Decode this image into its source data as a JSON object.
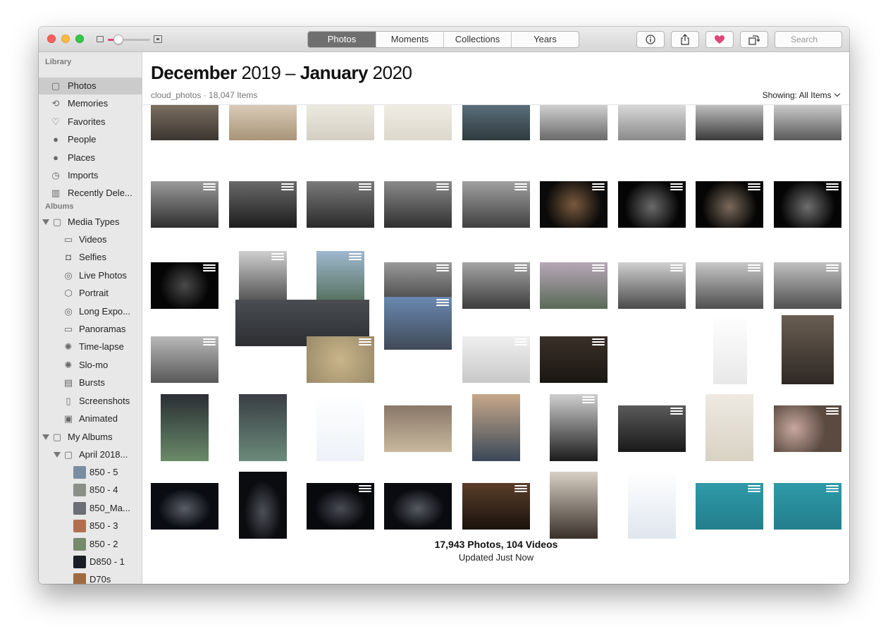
{
  "toolbar": {
    "tabs": [
      {
        "label": "Photos",
        "active": true
      },
      {
        "label": "Moments",
        "active": false
      },
      {
        "label": "Collections",
        "active": false
      },
      {
        "label": "Years",
        "active": false
      }
    ],
    "zoom_level": 0.25,
    "info_icon": "info-icon",
    "share_icon": "share-icon",
    "favorite_icon": "heart-icon",
    "rotate_icon": "rotate-icon",
    "search_placeholder": "Search"
  },
  "sidebar": {
    "library_header": "Library",
    "library_items": [
      {
        "label": "Photos",
        "icon": "photos-icon",
        "selected": true
      },
      {
        "label": "Memories",
        "icon": "memories-icon"
      },
      {
        "label": "Favorites",
        "icon": "heart-icon"
      },
      {
        "label": "People",
        "icon": "person-icon"
      },
      {
        "label": "Places",
        "icon": "pin-icon"
      },
      {
        "label": "Imports",
        "icon": "clock-icon"
      },
      {
        "label": "Recently Dele...",
        "icon": "trash-icon"
      }
    ],
    "albums_header": "Albums",
    "media_types_label": "Media Types",
    "media_types": [
      {
        "label": "Videos",
        "icon": "video-icon"
      },
      {
        "label": "Selfies",
        "icon": "camera-icon"
      },
      {
        "label": "Live Photos",
        "icon": "live-photo-icon"
      },
      {
        "label": "Portrait",
        "icon": "cube-icon"
      },
      {
        "label": "Long Expo...",
        "icon": "long-exposure-icon"
      },
      {
        "label": "Panoramas",
        "icon": "panorama-icon"
      },
      {
        "label": "Time-lapse",
        "icon": "timelapse-icon"
      },
      {
        "label": "Slo-mo",
        "icon": "slomo-icon"
      },
      {
        "label": "Bursts",
        "icon": "bursts-icon"
      },
      {
        "label": "Screenshots",
        "icon": "phone-icon"
      },
      {
        "label": "Animated",
        "icon": "animated-icon"
      }
    ],
    "my_albums_label": "My Albums",
    "folder_label": "April 2018...",
    "albums": [
      {
        "label": "850 - 5",
        "color": "#7a8ea0"
      },
      {
        "label": "850 - 4",
        "color": "#8b8f88"
      },
      {
        "label": "850_Ma...",
        "color": "#6b6e73"
      },
      {
        "label": "850 - 3",
        "color": "#b07050"
      },
      {
        "label": "850 - 2",
        "color": "#768a6c"
      },
      {
        "label": "D850 - 1",
        "color": "#1a1d24"
      },
      {
        "label": "D70s",
        "color": "#a06a40"
      }
    ]
  },
  "main": {
    "title_month_1": "December",
    "title_year_1": " 2019 – ",
    "title_month_2": "January",
    "title_year_2": " 2020",
    "subtitle": "cloud_photos · 18,047 Items",
    "showing_label": "Showing:",
    "showing_value": "All Items",
    "footer_count": "17,943 Photos, 104 Videos",
    "footer_updated": "Updated Just Now"
  },
  "photos": [
    {
      "row": 0,
      "col": 0,
      "bg": "linear-gradient(#7b6e60,#3c3530)",
      "kind": "photo"
    },
    {
      "row": 0,
      "col": 1,
      "bg": "linear-gradient(#d9cbb8,#a89478)",
      "kind": "photo"
    },
    {
      "row": 0,
      "col": 2,
      "bg": "linear-gradient(#ece9e0,#d4cfc2)",
      "kind": "photo"
    },
    {
      "row": 0,
      "col": 3,
      "bg": "linear-gradient(#efece4,#dcd8cc)",
      "kind": "photo"
    },
    {
      "row": 0,
      "col": 4,
      "bg": "linear-gradient(#5a6e7a,#2f3a3e)",
      "kind": "photo"
    },
    {
      "row": 0,
      "col": 5,
      "bg": "linear-gradient(#cfcfcf,#6a6a6a)",
      "kind": "photo"
    },
    {
      "row": 0,
      "col": 6,
      "bg": "linear-gradient(#d8d8d8,#8a8a8a)",
      "kind": "photo"
    },
    {
      "row": 0,
      "col": 7,
      "bg": "linear-gradient(#bfbfbf,#3a3a3a)",
      "kind": "photo"
    },
    {
      "row": 0,
      "col": 8,
      "bg": "linear-gradient(#c9c9c9,#5a5a5a)",
      "kind": "photo"
    },
    {
      "row": 1,
      "col": 0,
      "bg": "linear-gradient(#9b9b9b,#2e2e2e)",
      "kind": "edited"
    },
    {
      "row": 1,
      "col": 1,
      "bg": "linear-gradient(#6a6a6a,#1c1c1c)",
      "kind": "edited"
    },
    {
      "row": 1,
      "col": 2,
      "bg": "linear-gradient(#7a7a7a,#2a2a2a)",
      "kind": "edited"
    },
    {
      "row": 1,
      "col": 3,
      "bg": "linear-gradient(#8a8a8a,#303030)",
      "kind": "edited"
    },
    {
      "row": 1,
      "col": 4,
      "bg": "linear-gradient(#a0a0a0,#404040)",
      "kind": "edited"
    },
    {
      "row": 1,
      "col": 5,
      "bg": "radial-gradient(circle at 50% 50%,#7a5a3e,#0a0a0a 70%)",
      "kind": "edited"
    },
    {
      "row": 1,
      "col": 6,
      "bg": "radial-gradient(circle at 50% 55%,#6a6a6a,#050505 65%)",
      "kind": "edited"
    },
    {
      "row": 1,
      "col": 7,
      "bg": "radial-gradient(circle at 50% 55%,#7a6a5a,#050505 65%)",
      "kind": "edited"
    },
    {
      "row": 1,
      "col": 8,
      "bg": "radial-gradient(circle at 50% 55%,#6e6e6e,#050505 65%)",
      "kind": "edited"
    },
    {
      "row": 2,
      "col": 0,
      "bg": "radial-gradient(circle at 50% 50%,#4a4a4a,#050505 60%)",
      "kind": "edited"
    },
    {
      "row": 2,
      "col": 1,
      "bg": "linear-gradient(#cfcfcf,#2a2a2a)",
      "kind": "edited"
    },
    {
      "row": 2,
      "col": 2,
      "bg": "linear-gradient(#9fb8d0,#3e5a3a)",
      "kind": "edited"
    },
    {
      "row": 2,
      "col": 3,
      "bg": "linear-gradient(#9a9a9a,#3a3a3a)",
      "kind": "edited"
    },
    {
      "row": 2,
      "col": 4,
      "bg": "linear-gradient(#a5a5a5,#3c3c3c)",
      "kind": "edited"
    },
    {
      "row": 2,
      "col": 5,
      "bg": "linear-gradient(#b7a7b8,#5a6a58)",
      "kind": "edited"
    },
    {
      "row": 2,
      "col": 6,
      "bg": "linear-gradient(#d0d0d0,#4a4a4a)",
      "kind": "edited"
    },
    {
      "row": 2,
      "col": 7,
      "bg": "linear-gradient(#c8c8c8,#4e4e4e)",
      "kind": "edited"
    },
    {
      "row": 2,
      "col": 8,
      "bg": "linear-gradient(#c0c0c0,#505050)",
      "kind": "edited"
    },
    {
      "row": 3,
      "col": 0,
      "bg": "linear-gradient(#b9b9b9,#585858)",
      "kind": "edited"
    },
    {
      "row": 3,
      "col": 1,
      "bg": "linear-gradient(#4a4d52,#2c2e32)",
      "kind": "photo"
    },
    {
      "row": 3,
      "col": 2,
      "bg": "radial-gradient(circle,#c9b58a,#9a8a6a)",
      "kind": "edited"
    },
    {
      "row": 3,
      "col": 3,
      "bg": "linear-gradient(#6a88b0,#404a58)",
      "kind": "edited"
    },
    {
      "row": 3,
      "col": 4,
      "bg": "linear-gradient(#efefef,#c9c9c9)",
      "kind": "edited"
    },
    {
      "row": 3,
      "col": 5,
      "bg": "linear-gradient(#3a3028,#1a1612)",
      "kind": "edited"
    },
    {
      "row": 3,
      "col": 6,
      "bg": "linear-gradient(#ffffff,#e8e8e8)",
      "kind": "photo"
    },
    {
      "row": 3,
      "col": 7,
      "bg": "linear-gradient(#6a5e52,#2e2824)",
      "kind": "photo"
    },
    {
      "row": 4,
      "col": 0,
      "bg": "linear-gradient(#2a2e33,#6a8a6a)",
      "kind": "photo"
    },
    {
      "row": 4,
      "col": 1,
      "bg": "linear-gradient(#3a3e44,#6a8a7a)",
      "kind": "photo"
    },
    {
      "row": 4,
      "col": 2,
      "bg": "linear-gradient(#ffffff,#eef2f8)",
      "kind": "photo"
    },
    {
      "row": 4,
      "col": 3,
      "bg": "linear-gradient(#8a7868,#c8b89e)",
      "kind": "photo"
    },
    {
      "row": 4,
      "col": 4,
      "bg": "linear-gradient(#c8a88a,#3a4858)",
      "kind": "photo"
    },
    {
      "row": 4,
      "col": 5,
      "bg": "linear-gradient(#cfcfcf,#1c1c1c)",
      "kind": "edited"
    },
    {
      "row": 4,
      "col": 6,
      "bg": "linear-gradient(#5a5a5a,#1a1a1a)",
      "kind": "edited"
    },
    {
      "row": 4,
      "col": 7,
      "bg": "linear-gradient(#eeeae2,#d8d2c4)",
      "kind": "photo"
    },
    {
      "row": 4,
      "col": 8,
      "bg": "radial-gradient(circle at 30% 50%,#c8a8a0,#5a4a40 60%)",
      "kind": "edited"
    },
    {
      "row": 5,
      "col": 0,
      "bg": "radial-gradient(ellipse at 50% 55%,#5a5e68,#0a0c12 55%)",
      "kind": "photo"
    },
    {
      "row": 5,
      "col": 1,
      "bg": "radial-gradient(ellipse at 50% 60%,#4e5058,#0a0c10 55%)",
      "kind": "photo"
    },
    {
      "row": 5,
      "col": 2,
      "bg": "radial-gradient(ellipse at 50% 55%,#4a4c54,#08090d 55%)",
      "kind": "edited"
    },
    {
      "row": 5,
      "col": 3,
      "bg": "radial-gradient(ellipse at 50% 55%,#585a62,#0a0b10 55%)",
      "kind": "photo"
    },
    {
      "row": 5,
      "col": 4,
      "bg": "linear-gradient(#5a3e2a,#1a120c)",
      "kind": "edited"
    },
    {
      "row": 5,
      "col": 5,
      "bg": "linear-gradient(#d8d0c4,#3a302a)",
      "kind": "photo"
    },
    {
      "row": 5,
      "col": 6,
      "bg": "linear-gradient(#ffffff,#dfe6ee)",
      "kind": "photo"
    },
    {
      "row": 5,
      "col": 7,
      "bg": "linear-gradient(#2e9aa8,#237e8c)",
      "kind": "edited"
    },
    {
      "row": 5,
      "col": 8,
      "bg": "linear-gradient(#2e9aa8,#237e8c)",
      "kind": "edited"
    }
  ]
}
